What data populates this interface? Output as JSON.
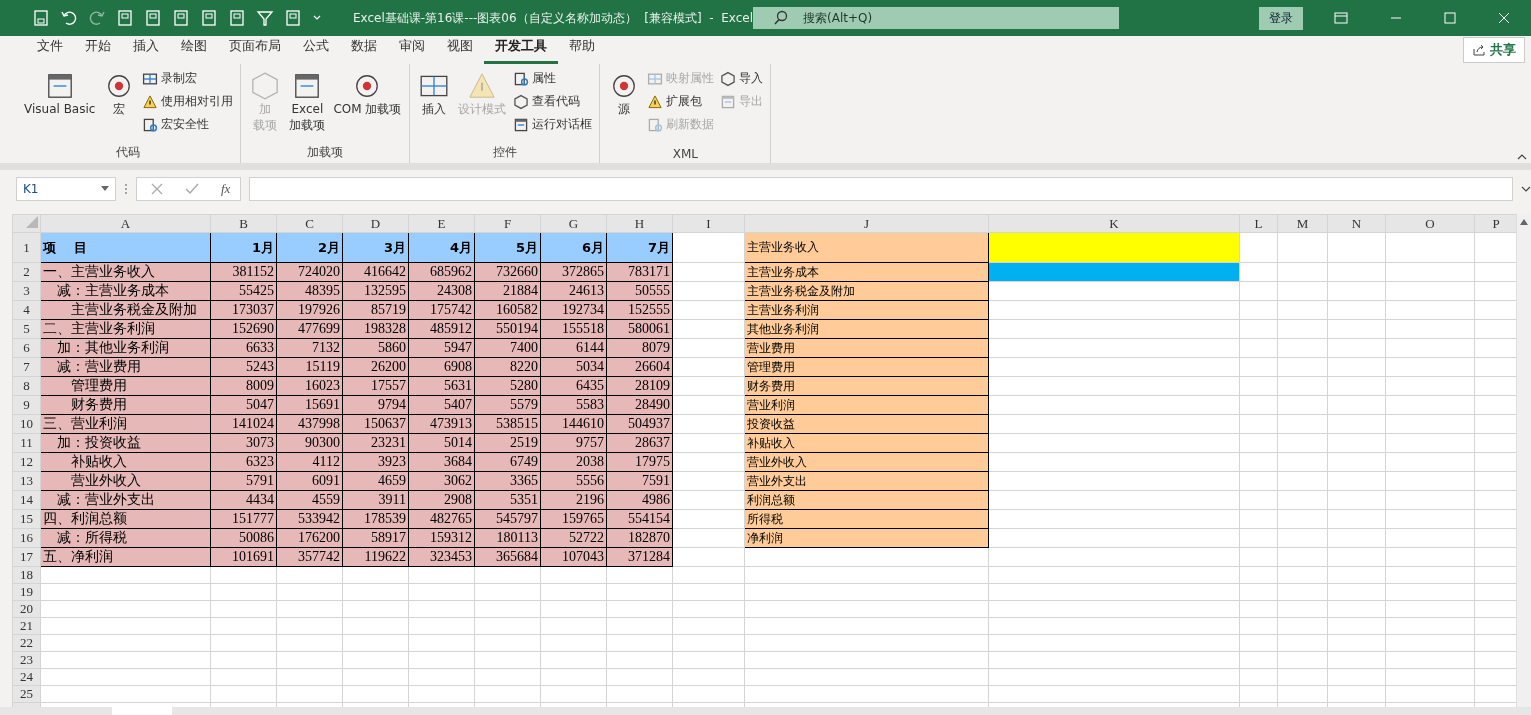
{
  "title_bar": {
    "title": "Excel基础课-第16课---图表06（自定义名称加动态）  [兼容模式]  -  Excel",
    "search_placeholder": "搜索(Alt+Q)",
    "sign_in": "登录"
  },
  "menu_tabs": [
    {
      "label": "文件",
      "selected": false
    },
    {
      "label": "开始",
      "selected": false
    },
    {
      "label": "插入",
      "selected": false
    },
    {
      "label": "绘图",
      "selected": false
    },
    {
      "label": "页面布局",
      "selected": false
    },
    {
      "label": "公式",
      "selected": false
    },
    {
      "label": "数据",
      "selected": false
    },
    {
      "label": "审阅",
      "selected": false
    },
    {
      "label": "视图",
      "selected": false
    },
    {
      "label": "开发工具",
      "selected": true
    },
    {
      "label": "帮助",
      "selected": false
    }
  ],
  "share_button": "共享",
  "ribbon_groups": [
    {
      "label": "代码",
      "items": [
        {
          "lines": [
            "Visual Basic"
          ],
          "kind": "large",
          "disabled": false
        },
        {
          "lines": [
            "宏"
          ],
          "kind": "large",
          "disabled": false
        },
        {
          "label": "录制宏",
          "kind": "small",
          "disabled": false
        },
        {
          "label": "使用相对引用",
          "kind": "small",
          "disabled": false
        },
        {
          "label": "宏安全性",
          "kind": "small",
          "disabled": false
        }
      ]
    },
    {
      "label": "加载项",
      "items": [
        {
          "lines": [
            "加",
            "载项"
          ],
          "kind": "large",
          "disabled": true
        },
        {
          "lines": [
            "Excel",
            "加载项"
          ],
          "kind": "large",
          "disabled": false
        },
        {
          "lines": [
            "COM 加载项"
          ],
          "kind": "large",
          "disabled": false
        }
      ]
    },
    {
      "label": "控件",
      "items": [
        {
          "lines": [
            "插入"
          ],
          "kind": "large",
          "disabled": false
        },
        {
          "lines": [
            "设计模式"
          ],
          "kind": "large",
          "disabled": true
        },
        {
          "label": "属性",
          "kind": "small",
          "disabled": false
        },
        {
          "label": "查看代码",
          "kind": "small",
          "disabled": false
        },
        {
          "label": "运行对话框",
          "kind": "small",
          "disabled": false
        }
      ]
    },
    {
      "label": "XML",
      "items": [
        {
          "lines": [
            "源"
          ],
          "kind": "large",
          "disabled": false
        },
        {
          "label": "映射属性",
          "kind": "small",
          "disabled": true
        },
        {
          "label": "扩展包",
          "kind": "small",
          "disabled": false
        },
        {
          "label": "刷新数据",
          "kind": "small",
          "disabled": true
        },
        {
          "label": "导入",
          "kind": "small",
          "disabled": false
        },
        {
          "label": "导出",
          "kind": "small",
          "disabled": true
        }
      ]
    }
  ],
  "formula_bar": {
    "name_box": "K1",
    "function_label": "fx"
  },
  "columns": [
    "A",
    "B",
    "C",
    "D",
    "E",
    "F",
    "G",
    "H",
    "I",
    "J",
    "K",
    "L",
    "M",
    "N",
    "O",
    "P"
  ],
  "rows": [
    {
      "number": "1",
      "kind": "header",
      "cells": [
        "项    目",
        "1月",
        "2月",
        "3月",
        "4月",
        "5月",
        "6月",
        "7月"
      ]
    },
    {
      "number": "2",
      "kind": "data",
      "cells": [
        "一、主营业务收入",
        "381152",
        "724020",
        "416642",
        "685962",
        "732660",
        "372865",
        "783171"
      ]
    },
    {
      "number": "3",
      "kind": "data",
      "cells": [
        "    减：主营业务成本",
        "55425",
        "48395",
        "132595",
        "24308",
        "21884",
        "24613",
        "50555"
      ]
    },
    {
      "number": "4",
      "kind": "data",
      "cells": [
        "        主营业务税金及附加",
        "173037",
        "197926",
        "85719",
        "175742",
        "160582",
        "192734",
        "152555"
      ]
    },
    {
      "number": "5",
      "kind": "data",
      "cells": [
        "二、主营业务利润",
        "152690",
        "477699",
        "198328",
        "485912",
        "550194",
        "155518",
        "580061"
      ]
    },
    {
      "number": "6",
      "kind": "data",
      "cells": [
        "    加：其他业务利润",
        "6633",
        "7132",
        "5860",
        "5947",
        "7400",
        "6144",
        "8079"
      ]
    },
    {
      "number": "7",
      "kind": "data",
      "cells": [
        "    减：营业费用",
        "5243",
        "15119",
        "26200",
        "6908",
        "8220",
        "5034",
        "26604"
      ]
    },
    {
      "number": "8",
      "kind": "data",
      "cells": [
        "        管理费用",
        "8009",
        "16023",
        "17557",
        "5631",
        "5280",
        "6435",
        "28109"
      ]
    },
    {
      "number": "9",
      "kind": "data",
      "cells": [
        "        财务费用",
        "5047",
        "15691",
        "9794",
        "5407",
        "5579",
        "5583",
        "28490"
      ]
    },
    {
      "number": "10",
      "kind": "data",
      "cells": [
        "三、营业利润",
        "141024",
        "437998",
        "150637",
        "473913",
        "538515",
        "144610",
        "504937"
      ]
    },
    {
      "number": "11",
      "kind": "data",
      "cells": [
        "    加：投资收益",
        "3073",
        "90300",
        "23231",
        "5014",
        "2519",
        "9757",
        "28637"
      ]
    },
    {
      "number": "12",
      "kind": "data",
      "cells": [
        "        补贴收入",
        "6323",
        "4112",
        "3923",
        "3684",
        "6749",
        "2038",
        "17975"
      ]
    },
    {
      "number": "13",
      "kind": "data",
      "cells": [
        "        营业外收入",
        "5791",
        "6091",
        "4659",
        "3062",
        "3365",
        "5556",
        "7591"
      ]
    },
    {
      "number": "14",
      "kind": "data",
      "cells": [
        "    减：营业外支出",
        "4434",
        "4559",
        "3911",
        "2908",
        "5351",
        "2196",
        "4986"
      ]
    },
    {
      "number": "15",
      "kind": "data",
      "cells": [
        "四、利润总额",
        "151777",
        "533942",
        "178539",
        "482765",
        "545797",
        "159765",
        "554154"
      ]
    },
    {
      "number": "16",
      "kind": "data",
      "cells": [
        "    减：所得税",
        "50086",
        "176200",
        "58917",
        "159312",
        "180113",
        "52722",
        "182870"
      ]
    },
    {
      "number": "17",
      "kind": "data",
      "cells": [
        "五、净利润",
        "101691",
        "357742",
        "119622",
        "323453",
        "365684",
        "107043",
        "371284"
      ]
    }
  ],
  "name_list": [
    "主营业务收入",
    "主营业务成本",
    "主营业务税金及附加",
    "主营业务利润",
    "其他业务利润",
    "营业费用",
    "管理费用",
    "财务费用",
    "营业利润",
    "投资收益",
    "补贴收入",
    "营业外收入",
    "营业外支出",
    "利润总额",
    "所得税",
    "净利润"
  ],
  "highlight_cells": [
    {
      "color": "#ffff00"
    },
    {
      "color": "#00b0f0"
    }
  ],
  "empty_rows": [
    "18",
    "19",
    "20",
    "21",
    "22",
    "23",
    "24",
    "25"
  ]
}
